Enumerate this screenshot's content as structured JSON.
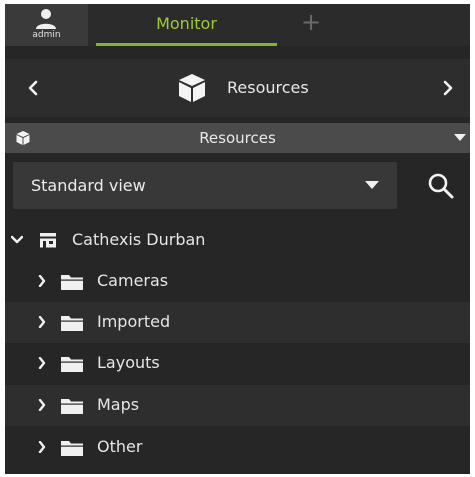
{
  "topbar": {
    "user_name": "admin",
    "active_tab": "Monitor",
    "add_tab_symbol": "+"
  },
  "resources_bar": {
    "title": "Resources",
    "left_icon": "chevron-left-icon",
    "right_icon": "chevron-right-icon",
    "main_icon": "cube-icon"
  },
  "section": {
    "title": "Resources",
    "icon": "cube-icon",
    "collapse_icon": "caret-down-icon"
  },
  "view_select": {
    "value": "Standard view"
  },
  "tree": {
    "root": {
      "label": "Cathexis Durban",
      "icon": "server-icon",
      "expanded": true
    },
    "items": [
      {
        "label": "Cameras"
      },
      {
        "label": "Imported"
      },
      {
        "label": "Layouts"
      },
      {
        "label": "Maps"
      },
      {
        "label": "Other"
      }
    ]
  },
  "colors": {
    "background": "#262626",
    "accent": "#9ecb3a",
    "section_header": "#4b4b4b"
  }
}
